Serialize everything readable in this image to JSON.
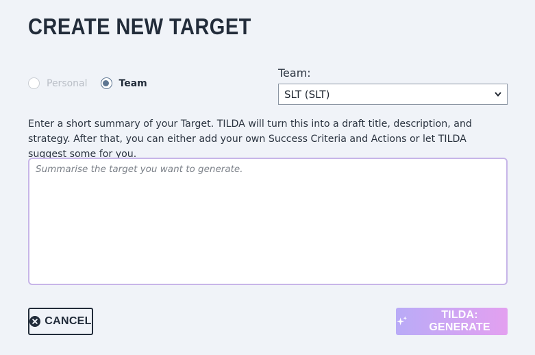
{
  "page": {
    "title": "CREATE NEW TARGET"
  },
  "target_type": {
    "options": [
      {
        "label": "Personal",
        "selected": false,
        "disabled": true
      },
      {
        "label": "Team",
        "selected": true,
        "disabled": false
      }
    ]
  },
  "team": {
    "label": "Team:",
    "selected_value": "SLT (SLT)"
  },
  "instructions": {
    "text": "Enter a short summary of your Target. TILDA will turn this into a draft title, description, and strategy. After that, you can either add your own Success Criteria and Actions or let TILDA suggest some for you."
  },
  "summary_input": {
    "value": "",
    "placeholder": "Summarise the target you want to generate."
  },
  "actions": {
    "cancel_label": "CANCEL",
    "cancel_icon": "close-circle-icon",
    "generate_label": "TILDA: GENERATE",
    "generate_icon": "sparkle-icon"
  },
  "colors": {
    "background": "#f0f3f8",
    "title": "#222c3a",
    "radio_selected": "#5d7591",
    "textarea_border": "#c7b5e8",
    "generate_gradient_start": "#b9abf7",
    "generate_gradient_end": "#e3a0f0"
  }
}
